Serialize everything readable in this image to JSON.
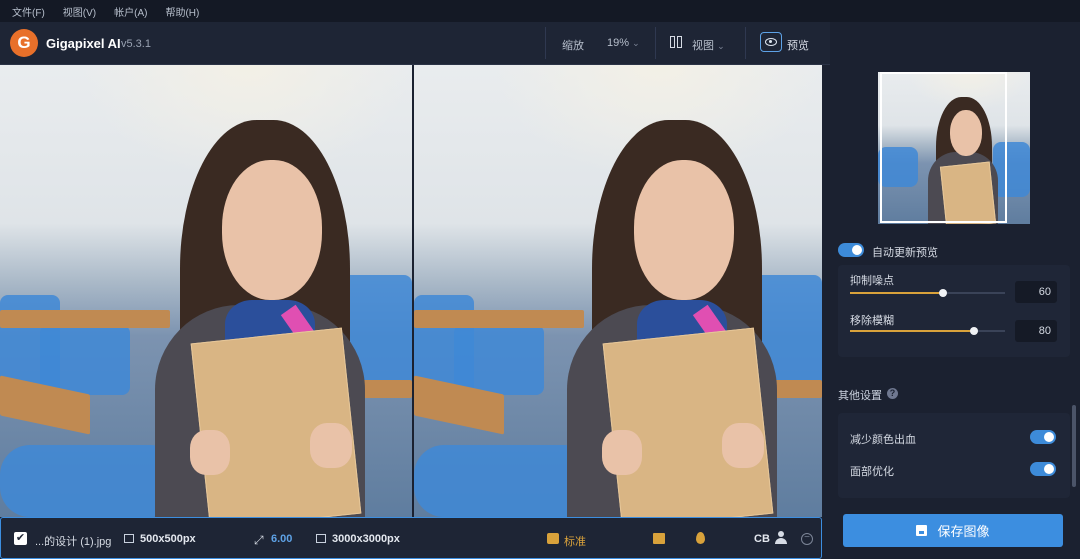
{
  "menu": {
    "items": [
      "文件(F)",
      "视图(V)",
      "帐户(A)",
      "帮助(H)"
    ]
  },
  "app": {
    "name": "Gigapixel AI",
    "version": "v5.3.1",
    "logo_letter": "G"
  },
  "toolbar": {
    "zoom_label": "缩放",
    "zoom_value": "19%",
    "view_label": "视图",
    "preview_label": "预览"
  },
  "panel": {
    "auto_update_label": "自动更新预览",
    "auto_update_on": true,
    "sliders": [
      {
        "label": "抑制噪点",
        "value": "60",
        "fraction": 0.6
      },
      {
        "label": "移除模糊",
        "value": "80",
        "fraction": 0.8
      }
    ],
    "other_settings_title": "其他设置",
    "help_icon": "?",
    "toggles": [
      {
        "label": "减少颜色出血",
        "on": true
      },
      {
        "label": "面部优化",
        "on": true
      }
    ],
    "save_label": "保存图像"
  },
  "bottom": {
    "filename": "...的设计 (1).jpg",
    "input_size": "500x500px",
    "scale": "6.00",
    "output_size": "3000x3000px",
    "model_label": "标准",
    "cb_label": "CB",
    "check_mark": "✔",
    "minus": "−"
  },
  "colors": {
    "accent": "#3c8ee0",
    "highlight": "#d9a23b",
    "logo": "#e8702a"
  }
}
